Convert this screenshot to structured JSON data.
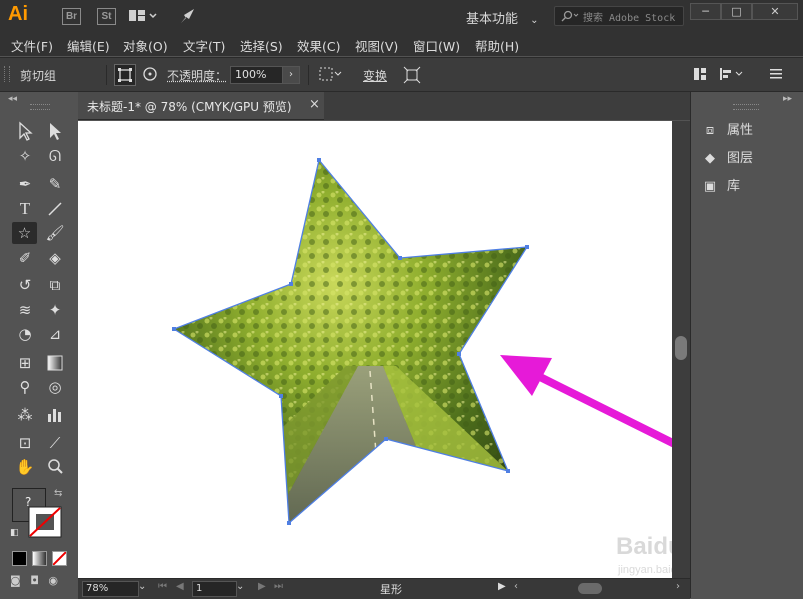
{
  "app": {
    "logo": "Ai",
    "bridge": "Br",
    "stock": "St",
    "workspace": "基本功能",
    "search_placeholder": "搜索 Adobe Stock"
  },
  "menu": [
    "文件(F)",
    "编辑(E)",
    "对象(O)",
    "文字(T)",
    "选择(S)",
    "效果(C)",
    "视图(V)",
    "窗口(W)",
    "帮助(H)"
  ],
  "control_bar": {
    "group_label": "剪切组",
    "opacity_label": "不透明度：",
    "opacity_value": "100%",
    "transform_label": "变换"
  },
  "document": {
    "tab_title": "未标题-1* @ 78% (CMYK/GPU 预览)",
    "close": "×"
  },
  "panels": [
    {
      "label": "属性",
      "icon": "properties-icon"
    },
    {
      "label": "图层",
      "icon": "layers-icon"
    },
    {
      "label": "库",
      "icon": "libraries-icon"
    }
  ],
  "status": {
    "zoom": "78%",
    "artboard_number": "1",
    "tool_name": "星形"
  },
  "colors": {
    "arrow": "#e61ad8",
    "selection": "#4f7fe3",
    "logo": "#ff9a00"
  },
  "watermark": {
    "brand": "Baidu经验",
    "url": "jingyan.baidu.com"
  }
}
